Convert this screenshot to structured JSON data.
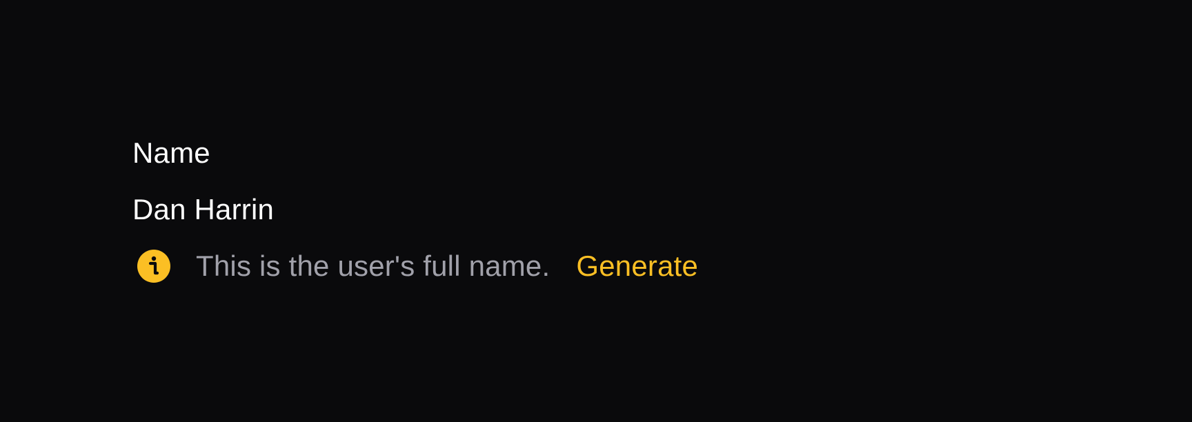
{
  "entry": {
    "label": "Name",
    "value": "Dan Harrin",
    "hint": {
      "icon": "info-circle-icon",
      "icon_color": "#fbbf24",
      "text": "This is the user's full name.",
      "action_label": "Generate",
      "action_color": "#fbbf24"
    }
  },
  "colors": {
    "background": "#0a0a0c",
    "label": "#ffffff",
    "value": "#ffffff",
    "hint_text": "#a1a1aa"
  }
}
